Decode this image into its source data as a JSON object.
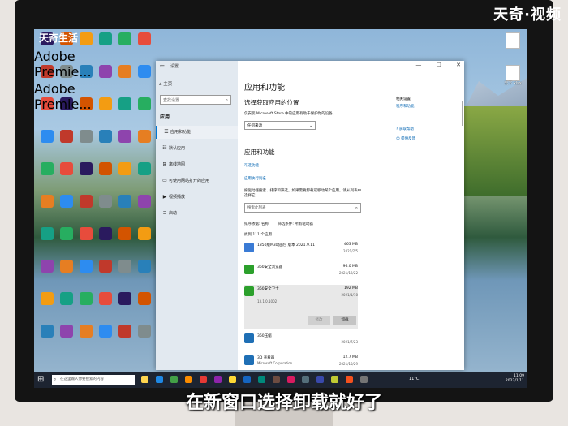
{
  "watermark": "天奇·视频",
  "brand": "天奇生活",
  "subtitle": "在新窗口选择卸载就好了",
  "desktop_icons": [
    {
      "label": "Adobe Premie...",
      "color": "#2a1a5e"
    },
    {
      "label": "Adobe Premie...",
      "color": "#2a1a5e"
    },
    {
      "label": "",
      "color": "#c0392b"
    },
    {
      "label": "",
      "color": "#2d8cf0"
    },
    {
      "label": "",
      "color": "#27ae60"
    },
    {
      "label": "",
      "color": "#e67e22"
    }
  ],
  "right_icons": [
    {
      "label": ""
    },
    {
      "label": "天下 xlsx"
    }
  ],
  "window": {
    "title": "设置",
    "minimize": "—",
    "maximize": "☐",
    "close": "✕",
    "sidebar": {
      "home": "主页",
      "search_placeholder": "查找设置",
      "section": "应用",
      "items": [
        {
          "icon": "☰",
          "label": "应用和功能"
        },
        {
          "icon": "☷",
          "label": "默认应用"
        },
        {
          "icon": "⊞",
          "label": "离线地图"
        },
        {
          "icon": "▭",
          "label": "可使用网站打开的应用"
        },
        {
          "icon": "▶",
          "label": "视频播放"
        },
        {
          "icon": "⊐",
          "label": "启动"
        }
      ]
    },
    "main": {
      "title": "应用和功能",
      "choose_title": "选择获取应用的位置",
      "choose_desc": "仅安装 Microsoft Store 中的应用有助于保护你的设备。",
      "dropdown_value": "任何来源",
      "apps_title": "应用和功能",
      "link_optional": "可选功能",
      "link_alias": "应用执行别名",
      "desc_line1": "按驱动器搜索、排序和筛选。如果需要卸载或移动某个应用，请从列表中",
      "desc_line2": "选择它。",
      "search_placeholder": "搜索此列表",
      "sort_label": "排序依据: 名称",
      "filter_label": "筛选条件: 所有驱动器",
      "found": "找到 111 个应用",
      "apps": [
        {
          "name": "1850版M3动画包 版本 2021.9.11",
          "publisher": "",
          "size": "463 MB",
          "date": "2021/7/5",
          "color": "#3a7bd5"
        },
        {
          "name": "360安全浏览器",
          "publisher": "",
          "size": "96.0 MB",
          "date": "2021/12/22",
          "color": "#2ca02c"
        },
        {
          "name": "360安全卫士",
          "publisher": "",
          "size": "192 MB",
          "date": "2021/1/10",
          "color": "#2ca02c",
          "version": "13.1.0.1002",
          "selected": true
        },
        {
          "name": "360压缩",
          "publisher": "",
          "size": "",
          "date": "2021/7/23",
          "color": "#1f6fb5"
        },
        {
          "name": "3D 查看器",
          "publisher": "Microsoft Corporation",
          "size": "12.7 MB",
          "date": "2021/10/29",
          "color": "#1f6fb5"
        }
      ],
      "btn_modify": "修改",
      "btn_uninstall": "卸载",
      "related_title": "相关设置",
      "related_link": "程序和功能",
      "help": "获取帮助",
      "feedback": "提供反馈"
    }
  },
  "taskbar": {
    "search_placeholder": "在这里输入你要搜索的内容",
    "weather": "11°C",
    "time": "11:09",
    "date": "2022/1/11"
  }
}
